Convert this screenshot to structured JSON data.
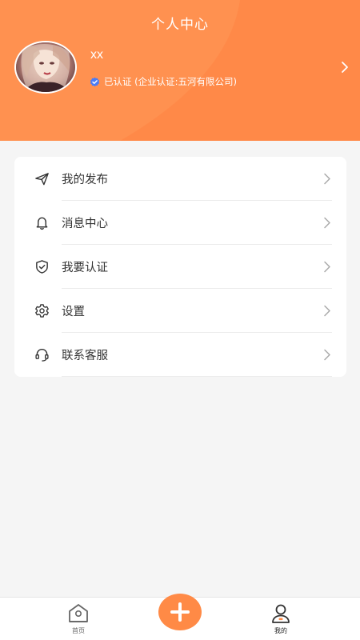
{
  "header": {
    "title": "个人中心",
    "background_color": "#ff9150"
  },
  "profile": {
    "name": "xx",
    "verify_text": "已认证 (企业认证:五河有限公司)",
    "verify_icon": "verified-badge-icon",
    "verify_icon_color": "#4a7cf6"
  },
  "menu": {
    "items": [
      {
        "label": "我的发布",
        "icon": "send-icon"
      },
      {
        "label": "消息中心",
        "icon": "bell-icon"
      },
      {
        "label": "我要认证",
        "icon": "shield-check-icon"
      },
      {
        "label": "设置",
        "icon": "gear-icon"
      },
      {
        "label": "联系客服",
        "icon": "headset-icon"
      }
    ]
  },
  "bottom_nav": {
    "items": [
      {
        "label": "首页",
        "icon": "home-icon",
        "active": false
      },
      {
        "label": "我的",
        "icon": "user-icon",
        "active": true
      }
    ],
    "fab_icon": "plus-icon",
    "fab_color": "#ff8a46"
  }
}
